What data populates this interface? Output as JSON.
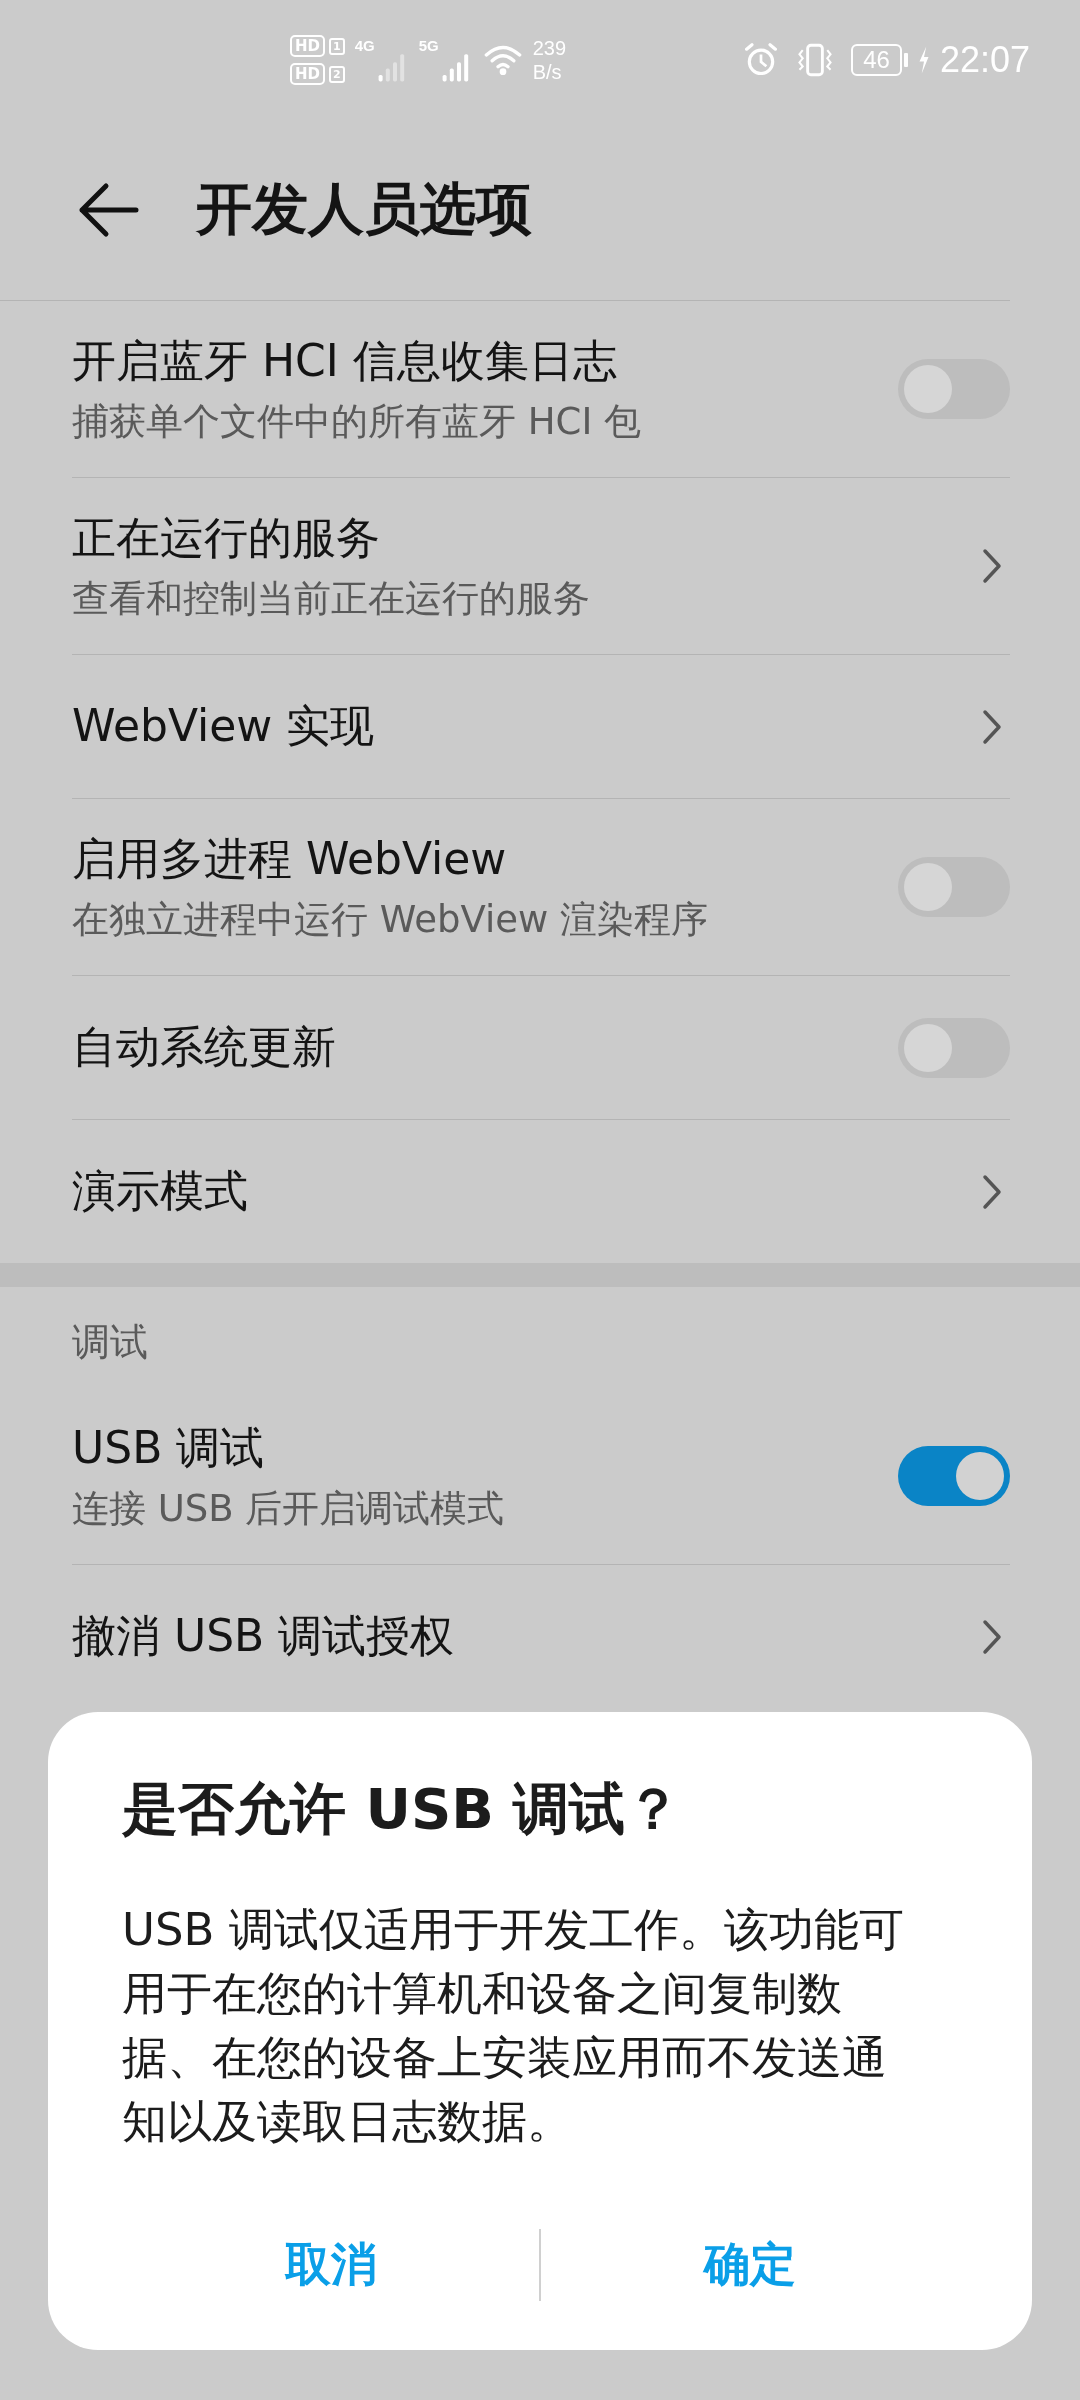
{
  "status_bar": {
    "sims": [
      {
        "hd": "HD",
        "slot": "1",
        "network": "4G"
      },
      {
        "hd": "HD",
        "slot": "2",
        "network": "5G"
      }
    ],
    "speed": "239",
    "speed_unit": "B/s",
    "battery": "46",
    "time": "22:07"
  },
  "header": {
    "title": "开发人员选项"
  },
  "items": [
    {
      "kind": "switch",
      "title": "开启蓝牙 HCI 信息收集日志",
      "subtitle": "捕获单个文件中的所有蓝牙 HCI 包",
      "on": false
    },
    {
      "kind": "link",
      "title": "正在运行的服务",
      "subtitle": "查看和控制当前正在运行的服务"
    },
    {
      "kind": "link",
      "title": "WebView 实现"
    },
    {
      "kind": "switch",
      "title": "启用多进程 WebView",
      "subtitle": "在独立进程中运行 WebView 渲染程序",
      "on": false
    },
    {
      "kind": "switch",
      "title": "自动系统更新",
      "on": false
    },
    {
      "kind": "link",
      "title": "演示模式"
    }
  ],
  "section": {
    "title": "调试",
    "items": [
      {
        "kind": "switch",
        "title": "USB 调试",
        "subtitle": "连接 USB 后开启调试模式",
        "on": true
      },
      {
        "kind": "link",
        "title": "撤消 USB 调试授权"
      }
    ]
  },
  "dialog": {
    "title": "是否允许 USB 调试？",
    "message": "USB 调试仅适用于开发工作。该功能可用于在您的计算机和设备之间复制数据、在您的设备上安装应用而不发送通知以及读取日志数据。",
    "buttons": [
      "取消",
      "确定"
    ]
  }
}
